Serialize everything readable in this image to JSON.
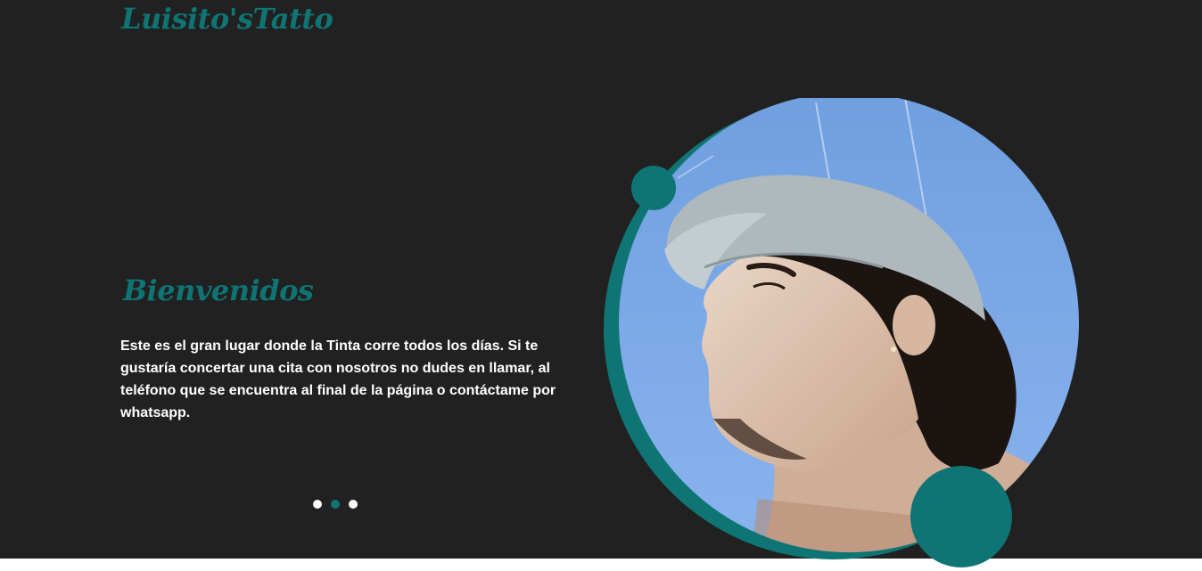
{
  "brand": {
    "name": "Luisito'sTatto"
  },
  "hero": {
    "heading": "Bienvenidos",
    "text": "Este es el gran lugar donde la Tinta corre todos los días. Si te gustaría concertar una cita con nosotros no dudes en llamar, al teléfono que se encuentra al final de la página o contáctame por whatsapp.",
    "image": "portrait-photo",
    "carousel": {
      "slides": 3,
      "active_index": 2
    }
  },
  "colors": {
    "background": "#212121",
    "accent": "#0f7474",
    "text": "#ffffff",
    "sky": "#7fa9e6"
  }
}
